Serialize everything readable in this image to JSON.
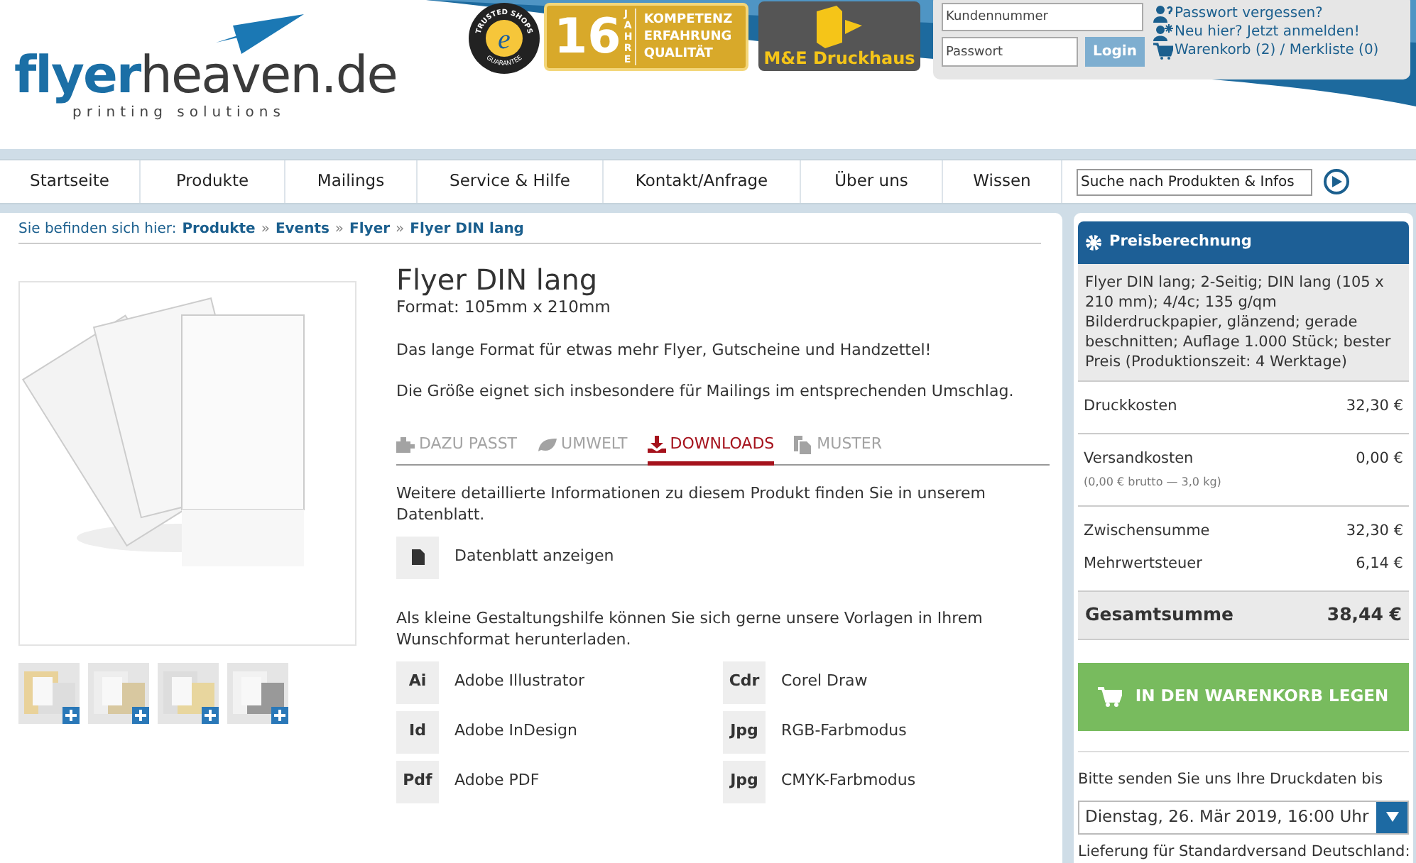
{
  "header": {
    "logo": {
      "brand_main": "flyer",
      "brand_rest": "heaven.de",
      "tagline": "printing solutions"
    },
    "trusted_badge": {
      "top": "TRUSTED SHOPS",
      "center": "e",
      "bottom": "GUARANTEE"
    },
    "years_badge": {
      "number": "16",
      "unit": "JAHRE",
      "lines": [
        "KOMPETENZ",
        "ERFAHRUNG",
        "QUALITÄT"
      ]
    },
    "druckhaus_badge": {
      "name": "M&E Druckhaus"
    },
    "login": {
      "customer_placeholder": "Kundennummer",
      "password_placeholder": "Passwort",
      "button": "Login"
    },
    "links": [
      {
        "kind": "forgot",
        "text": "Passwort vergessen?"
      },
      {
        "kind": "register",
        "text": "Neu hier? Jetzt anmelden!"
      },
      {
        "kind": "cart",
        "text": "Warenkorb (2) / Merkliste (0)"
      }
    ]
  },
  "nav": {
    "items": [
      "Startseite",
      "Produkte",
      "Mailings",
      "Service & Hilfe",
      "Kontakt/Anfrage",
      "Über uns",
      "Wissen"
    ],
    "search": {
      "value": "Suche nach Produkten & Infos"
    }
  },
  "breadcrumb": {
    "prefix": "Sie befinden sich hier:",
    "separator": "»",
    "items": [
      "Produkte",
      "Events",
      "Flyer",
      "Flyer DIN lang"
    ]
  },
  "product": {
    "title": "Flyer DIN lang",
    "format": "Format: 105mm x 210mm",
    "paragraphs": [
      "Das lange Format für etwas mehr Flyer, Gutscheine und Handzettel!",
      "Die Größe eignet sich insbesondere für Mailings im entsprechenden Umschlag."
    ],
    "tabs": [
      {
        "kind": "puzzle",
        "label": "DAZU PASST",
        "selected": false
      },
      {
        "kind": "leaf",
        "label": "UMWELT",
        "selected": false
      },
      {
        "kind": "download",
        "label": "DOWNLOADS",
        "selected": true
      },
      {
        "kind": "copy",
        "label": "MUSTER",
        "selected": false
      }
    ],
    "info": "Weitere detaillierte Informationen zu diesem Produkt finden Sie in unserem Datenblatt.",
    "datasheet": "Datenblatt anzeigen",
    "templates_intro": "Als kleine Gestaltungshilfe können Sie sich gerne unsere Vorlagen in Ihrem Wunschformat herunterladen.",
    "templates": [
      {
        "badge": "Ai",
        "label": "Adobe Illustrator"
      },
      {
        "badge": "Cdr",
        "label": "Corel Draw"
      },
      {
        "badge": "Id",
        "label": "Adobe InDesign"
      },
      {
        "badge": "Jpg",
        "label": "RGB-Farbmodus"
      },
      {
        "badge": "Pdf",
        "label": "Adobe PDF"
      },
      {
        "badge": "Jpg",
        "label": "CMYK-Farbmodus"
      }
    ]
  },
  "price": {
    "title": "Preisberechnung",
    "description": "Flyer DIN lang; 2-Seitig; DIN lang (105 x 210 mm); 4/4c; 135 g/qm Bilderdruckpapier, glänzend; gerade beschnitten; Auflage 1.000 Stück; bester Preis (Produktionszeit: 4 Werktage)",
    "groups": [
      [
        {
          "label": "Druckkosten",
          "value": "32,30 €"
        }
      ],
      [
        {
          "label": "Versandkosten",
          "value": "0,00 €",
          "note": "(0,00 € brutto — 3,0 kg)"
        }
      ],
      [
        {
          "label": "Zwischensumme",
          "value": "32,30 €"
        },
        {
          "label": "Mehrwertsteuer",
          "value": "6,14 €"
        }
      ]
    ],
    "total": {
      "label": "Gesamtsumme",
      "value": "38,44 €"
    },
    "cart_button": "IN DEN WARENKORB LEGEN",
    "deadline_label": "Bitte senden Sie uns Ihre Druckdaten bis",
    "deadline": "Dienstag, 26. Mär 2019, 16:00 Uhr",
    "delivery_label": "Lieferung für Standardversand Deutschland:"
  }
}
